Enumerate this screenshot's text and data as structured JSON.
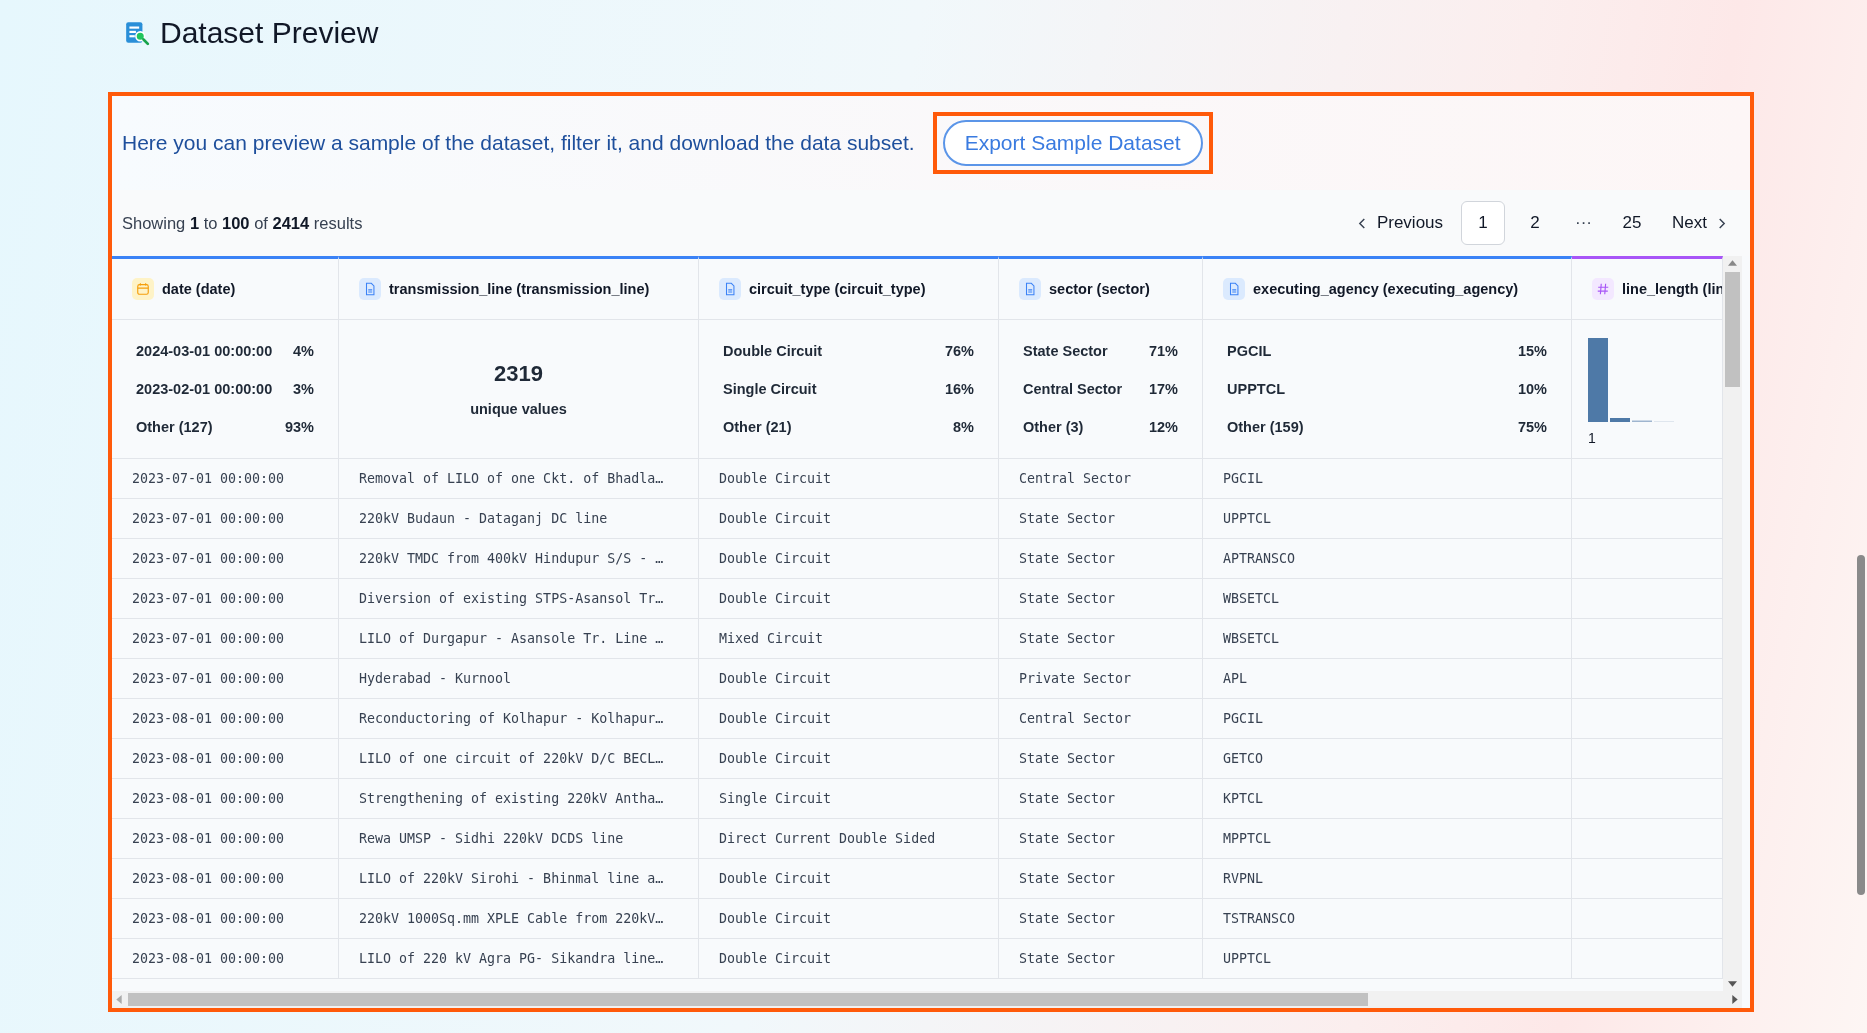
{
  "page_title": "Dataset Preview",
  "panel": {
    "highlighted": true,
    "intro": "Here you can preview a sample of the dataset, filter it, and download the data subset.",
    "export_button": {
      "label": "Export Sample Dataset",
      "highlighted": true
    },
    "results": "Showing **1** to **100** of **2414** results",
    "pagination": [
      {
        "kind": "prev",
        "label": "Previous"
      },
      {
        "kind": "page",
        "label": "1",
        "selected": true
      },
      {
        "kind": "page",
        "label": "2",
        "selected": false
      },
      {
        "kind": "ellipsis",
        "label": "···"
      },
      {
        "kind": "page",
        "label": "25",
        "selected": false
      },
      {
        "kind": "next",
        "label": "Next"
      }
    ]
  },
  "table": {
    "columns": [
      {
        "kind": "date",
        "name": "date (date)",
        "summary": {
          "kind": "top_values",
          "items": [
            {
              "label": "2024-03-01 00:00:00",
              "share": "4%"
            },
            {
              "label": "2023-02-01 00:00:00",
              "share": "3%"
            },
            {
              "label": "Other (127)",
              "share": "93%"
            }
          ]
        }
      },
      {
        "kind": "text",
        "name": "transmission_line (transmission_line)",
        "summary": {
          "kind": "unique",
          "value": "2319",
          "caption": "unique values"
        }
      },
      {
        "kind": "text",
        "name": "circuit_type (circuit_type)",
        "summary": {
          "kind": "top_values",
          "items": [
            {
              "label": "Double Circuit",
              "share": "76%"
            },
            {
              "label": "Single Circuit",
              "share": "16%"
            },
            {
              "label": "Other (21)",
              "share": "8%"
            }
          ]
        }
      },
      {
        "kind": "text",
        "name": "sector (sector)",
        "summary": {
          "kind": "top_values",
          "items": [
            {
              "label": "State Sector",
              "share": "71%"
            },
            {
              "label": "Central Sector",
              "share": "17%"
            },
            {
              "label": "Other (3)",
              "share": "12%"
            }
          ]
        }
      },
      {
        "kind": "text",
        "name": "executing_agency (executing_agency)",
        "summary": {
          "kind": "top_values",
          "items": [
            {
              "label": "PGCIL",
              "share": "15%"
            },
            {
              "label": "UPPTCL",
              "share": "10%"
            },
            {
              "label": "Other (159)",
              "share": "75%"
            }
          ]
        }
      },
      {
        "kind": "number",
        "name": "line_length (lin",
        "summary": {
          "kind": "histogram",
          "axis_label": "1"
        }
      }
    ],
    "rows": [
      [
        "2023-07-01 00:00:00",
        "Removal of LILO of one Ckt. of Bhadla…",
        "Double Circuit",
        "Central Sector",
        "PGCIL"
      ],
      [
        "2023-07-01 00:00:00",
        "220kV Budaun - Dataganj DC line",
        "Double Circuit",
        "State Sector",
        "UPPTCL"
      ],
      [
        "2023-07-01 00:00:00",
        "220kV TMDC from 400kV Hindupur S/S - …",
        "Double Circuit",
        "State Sector",
        "APTRANSCO"
      ],
      [
        "2023-07-01 00:00:00",
        "Diversion of existing STPS-Asansol Tr…",
        "Double Circuit",
        "State Sector",
        "WBSETCL"
      ],
      [
        "2023-07-01 00:00:00",
        "LILO of Durgapur - Asansole Tr. Line …",
        "Mixed Circuit",
        "State Sector",
        "WBSETCL"
      ],
      [
        "2023-07-01 00:00:00",
        "Hyderabad - Kurnool",
        "Double Circuit",
        "Private Sector",
        "APL"
      ],
      [
        "2023-08-01 00:00:00",
        "Reconductoring of Kolhapur - Kolhapur…",
        "Double Circuit",
        "Central Sector",
        "PGCIL"
      ],
      [
        "2023-08-01 00:00:00",
        "LILO of one circuit of 220kV D/C BECL…",
        "Double Circuit",
        "State Sector",
        "GETCO"
      ],
      [
        "2023-08-01 00:00:00",
        "Strengthening of existing 220kV Antha…",
        "Single Circuit",
        "State Sector",
        "KPTCL"
      ],
      [
        "2023-08-01 00:00:00",
        "Rewa UMSP - Sidhi 220kV DCDS line",
        "Direct Current Double Sided",
        "State Sector",
        "MPPTCL"
      ],
      [
        "2023-08-01 00:00:00",
        "LILO of 220kV Sirohi - Bhinmal line a…",
        "Double Circuit",
        "State Sector",
        "RVPNL"
      ],
      [
        "2023-08-01 00:00:00",
        "220kV 1000Sq.mm XPLE Cable from 220kV…",
        "Double Circuit",
        "State Sector",
        "TSTRANSCO"
      ],
      [
        "2023-08-01 00:00:00",
        "LILO of 220 kV Agra PG- Sikandra line…",
        "Double Circuit",
        "State Sector",
        "UPPTCL"
      ]
    ]
  }
}
